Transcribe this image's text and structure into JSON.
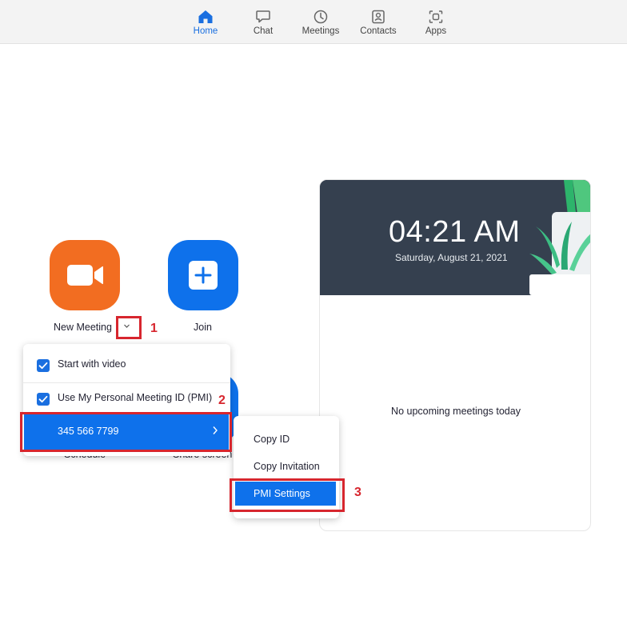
{
  "nav": {
    "items": [
      {
        "label": "Home",
        "icon": "home-icon",
        "active": true
      },
      {
        "label": "Chat",
        "icon": "chat-icon"
      },
      {
        "label": "Meetings",
        "icon": "clock-icon"
      },
      {
        "label": "Contacts",
        "icon": "contacts-icon"
      },
      {
        "label": "Apps",
        "icon": "apps-icon"
      }
    ]
  },
  "actions": {
    "new_meeting": {
      "label": "New Meeting",
      "icon": "video-camera-icon",
      "color": "#f26d21"
    },
    "join": {
      "label": "Join",
      "icon": "plus-icon",
      "color": "#0e71eb"
    },
    "schedule": {
      "label": "Schedule"
    },
    "share_screen": {
      "label": "Share screen"
    }
  },
  "menu": {
    "start_with_video": {
      "label": "Start with video",
      "checked": true
    },
    "use_pmi": {
      "label": "Use My Personal Meeting ID (PMI)",
      "checked": true
    },
    "pmi_number": "345 566 7799"
  },
  "submenu": {
    "items": [
      "Copy ID",
      "Copy Invitation",
      "PMI Settings"
    ]
  },
  "callouts": [
    "1",
    "2",
    "3"
  ],
  "card": {
    "time": "04:21 AM",
    "date": "Saturday, August 21, 2021",
    "empty_message": "No upcoming meetings today"
  },
  "colors": {
    "accent": "#0e71eb",
    "orange": "#f26d21",
    "callout": "#d7262e",
    "banner": "#35404f"
  }
}
